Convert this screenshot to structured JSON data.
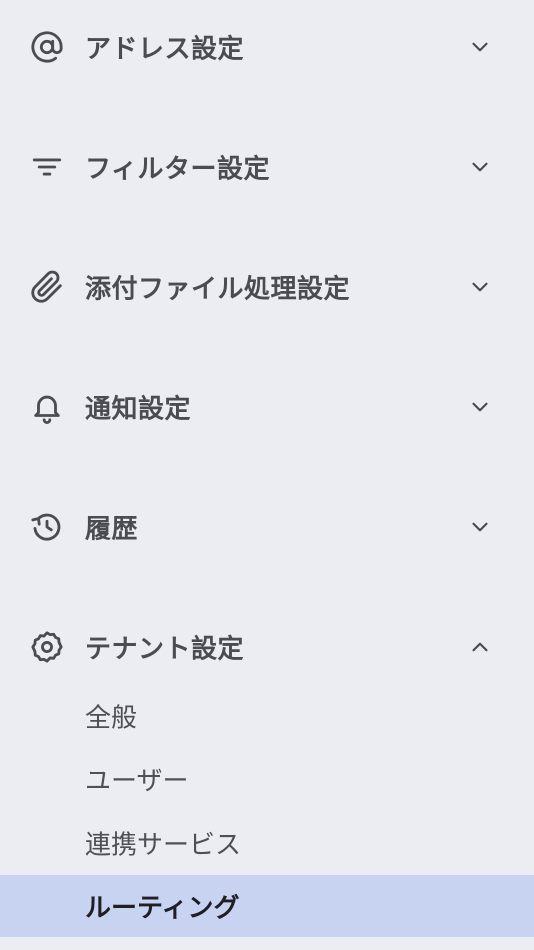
{
  "sections": [
    {
      "label": "アドレス設定",
      "icon": "at-sign-icon",
      "expanded": false
    },
    {
      "label": "フィルター設定",
      "icon": "filter-icon",
      "expanded": false
    },
    {
      "label": "添付ファイル処理設定",
      "icon": "paperclip-icon",
      "expanded": false
    },
    {
      "label": "通知設定",
      "icon": "bell-icon",
      "expanded": false
    },
    {
      "label": "履歴",
      "icon": "history-icon",
      "expanded": false
    },
    {
      "label": "テナント設定",
      "icon": "gear-icon",
      "expanded": true
    }
  ],
  "tenant_subitems": [
    {
      "label": "全般",
      "active": false
    },
    {
      "label": "ユーザー",
      "active": false
    },
    {
      "label": "連携サービス",
      "active": false
    },
    {
      "label": "ルーティング",
      "active": true
    }
  ],
  "colors": {
    "background": "#ecedf2",
    "active_background": "#c7d3f1",
    "text": "#4b4b52",
    "active_text": "#1f1f24"
  }
}
